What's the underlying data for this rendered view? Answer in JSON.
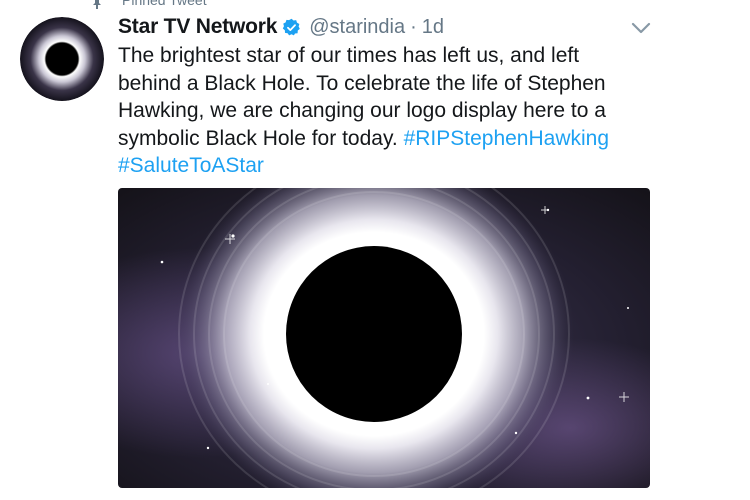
{
  "pinned_label": "Pinned Tweet",
  "tweet": {
    "author": {
      "display_name": "Star TV Network",
      "verified": true,
      "handle": "@starindia",
      "separator": "·",
      "timestamp": "1d"
    },
    "text_lines": [
      "The brightest star of our times has left us, and left",
      "behind a Black Hole. To celebrate the life of Stephen",
      "Hawking, we are changing our logo display here to a",
      "symbolic Black Hole for today. "
    ],
    "hashtags": [
      "#RIPStephenHawking",
      "#SaluteToAStar"
    ],
    "media_description_icon": "black-hole-image"
  },
  "colors": {
    "link": "#1da1f2",
    "muted": "#657786",
    "verified_badge": "#1da1f2"
  }
}
